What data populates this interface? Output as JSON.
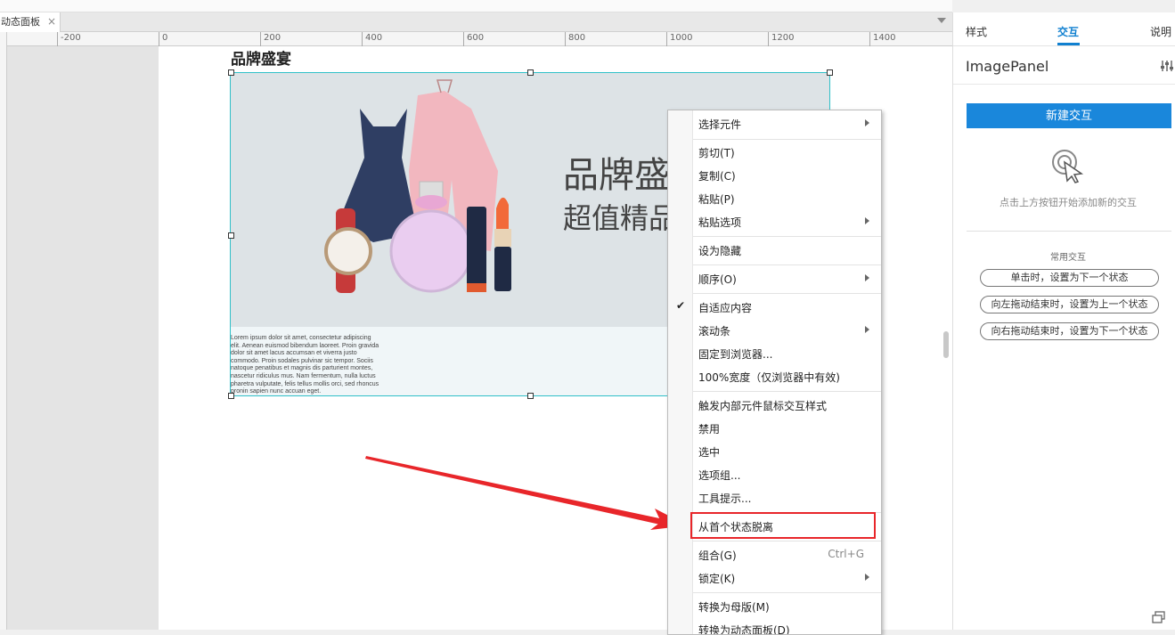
{
  "tabs": [
    {
      "label": "动态面板"
    }
  ],
  "ruler": {
    "ticks": [
      "-200",
      "0",
      "200",
      "400",
      "600",
      "800",
      "1000",
      "1200",
      "1400"
    ]
  },
  "canvas": {
    "heading": "品牌盛宴",
    "banner": {
      "title": "品牌盛",
      "subtitle": "超值精品"
    },
    "lorem": "Lorem ipsum dolor sit amet, consectetur adipiscing elit. Aenean euismod bibendum laoreet. Proin gravida dolor sit amet lacus accumsan et viverra justo commodo. Proin sodales pulvinar sic tempor. Sociis natoque penatibus et magnis dis parturient montes, nascetur ridiculus mus. Nam fermentum, nulla luctus pharetra vulputate, felis tellus mollis orci, sed rhoncus pronin sapien nunc accuan eget."
  },
  "context_menu": {
    "items": [
      {
        "label": "选择元件",
        "submenu": true
      },
      {
        "label": "剪切(T)"
      },
      {
        "label": "复制(C)"
      },
      {
        "label": "粘贴(P)"
      },
      {
        "label": "粘贴选项",
        "submenu": true
      },
      {
        "label": "设为隐藏"
      },
      {
        "label": "顺序(O)",
        "submenu": true
      },
      {
        "label": "自适应内容",
        "checked": true
      },
      {
        "label": "滚动条",
        "submenu": true
      },
      {
        "label": "固定到浏览器..."
      },
      {
        "label": "100%宽度（仅浏览器中有效)"
      },
      {
        "label": "触发内部元件鼠标交互样式"
      },
      {
        "label": "禁用"
      },
      {
        "label": "选中"
      },
      {
        "label": "选项组..."
      },
      {
        "label": "工具提示..."
      },
      {
        "label": "从首个状态脱离",
        "highlighted": true
      },
      {
        "label": "组合(G)",
        "shortcut": "Ctrl+G"
      },
      {
        "label": "锁定(K)",
        "submenu": true
      },
      {
        "label": "转换为母版(M)"
      },
      {
        "label": "转换为动态面板(D)"
      }
    ]
  },
  "right_panel": {
    "tabs": [
      "样式",
      "交互",
      "说明"
    ],
    "active_tab": "交互",
    "title": "ImagePanel",
    "new_interaction": "新建交互",
    "hint": "点击上方按钮开始添加新的交互",
    "common_label": "常用交互",
    "common_items": [
      "单击时，设置为下一个状态",
      "向左拖动结束时，设置为上一个状态",
      "向右拖动结束时，设置为下一个状态"
    ]
  },
  "colors": {
    "accent": "#1a87db",
    "highlight": "#e8262a",
    "selection": "#30c0c8"
  }
}
